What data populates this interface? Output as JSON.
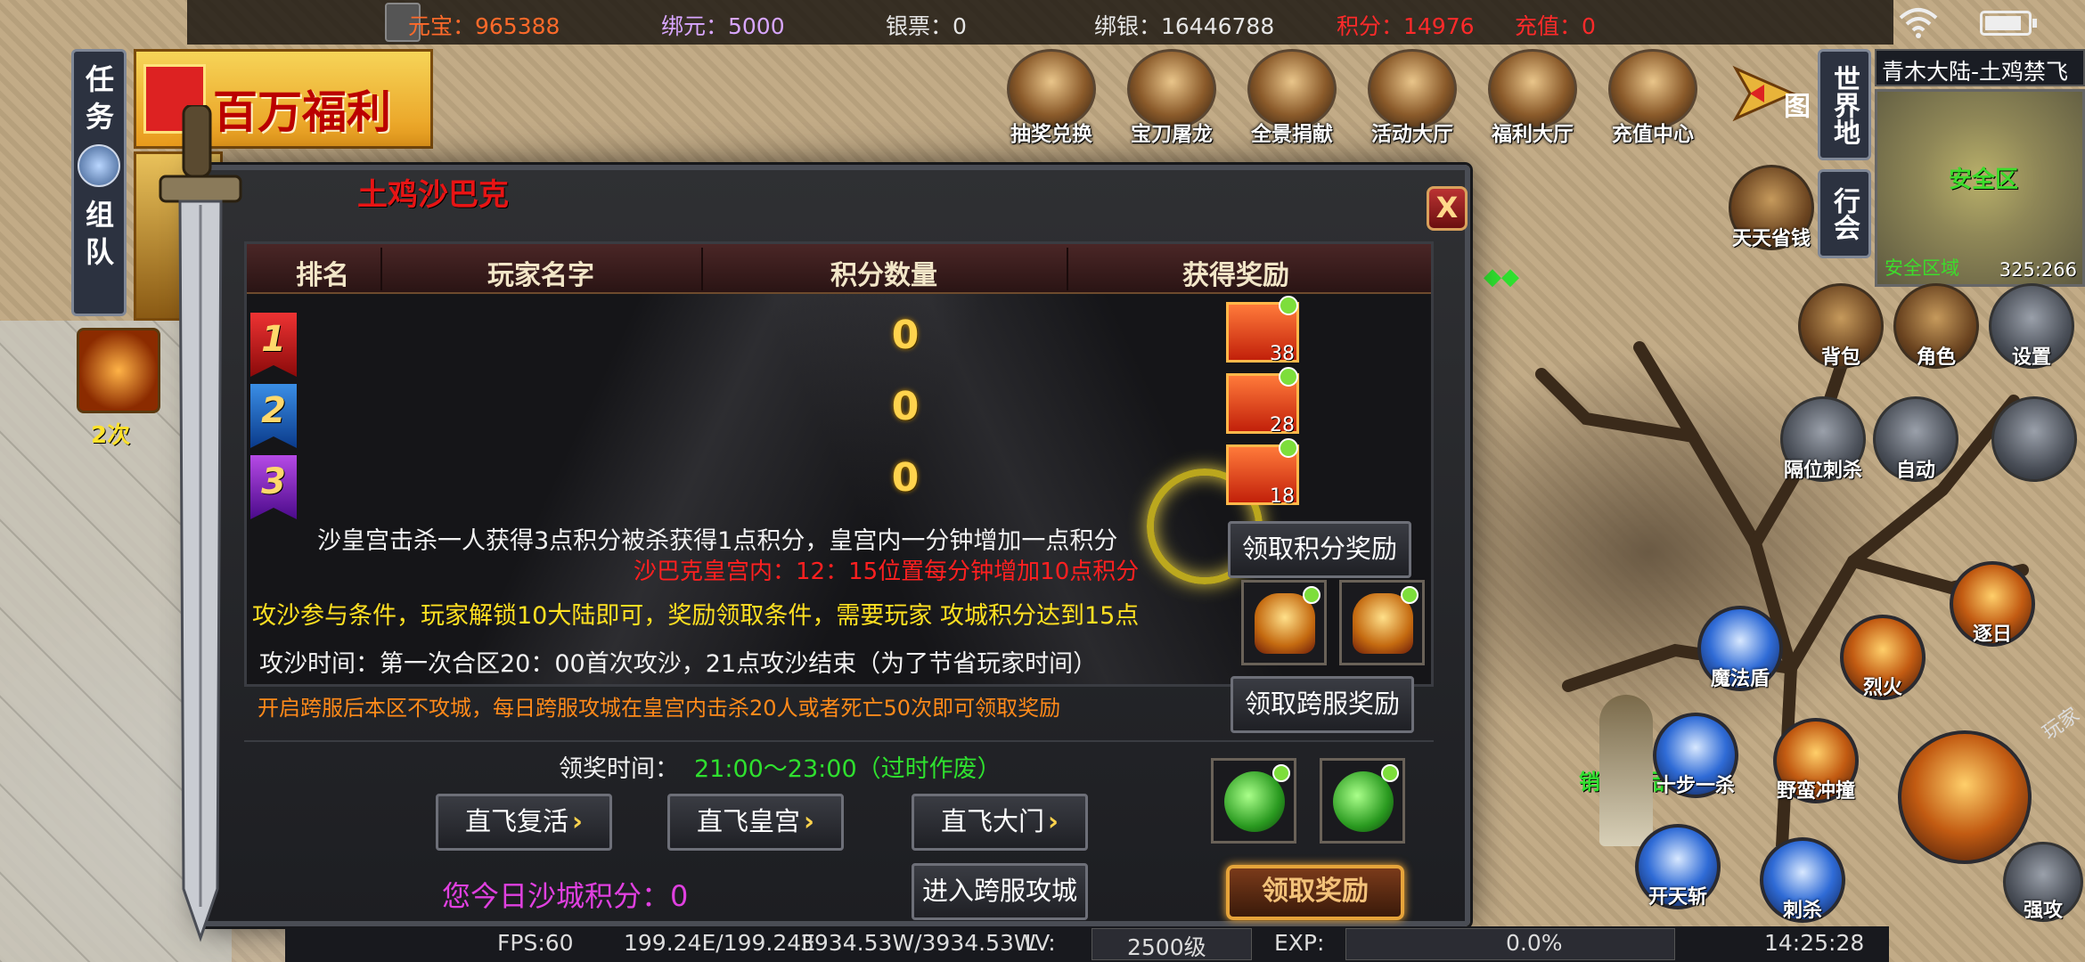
{
  "topbar": {
    "yuanbao": "元宝：965388",
    "bangyuan": "绑元：5000",
    "yinpiao": "银票：0",
    "bangyin": "绑银：16446788",
    "jifen": "积分：14976",
    "chongzhi": "充值：0"
  },
  "features": [
    "抽奖兑换",
    "宝刀屠龙",
    "全景捐献",
    "活动大厅",
    "福利大厅",
    "充值中心"
  ],
  "right_panel": {
    "world_map": "世界地图",
    "guild": "行会",
    "map_name": "青木大陆-土鸡禁飞",
    "safe_zone": "安全区",
    "area_label": "安全区域",
    "coords": "325:266",
    "save_money": "天天省钱",
    "bag": "背包",
    "role": "角色",
    "settings": "设置",
    "skill_stealth": "隔位刺杀",
    "auto": "自动"
  },
  "skills": [
    "逐日",
    "魔法盾",
    "烈火",
    "十步一杀",
    "野蛮冲撞",
    "开天斩",
    "刺杀",
    "强攻",
    "玩家"
  ],
  "left_panel": {
    "task": "任务",
    "team": "组队",
    "welfare": "百万福利",
    "charge_times": "2次"
  },
  "dialog": {
    "title": "土鸡沙巴克",
    "close": "X",
    "headers": [
      "排名",
      "玩家名字",
      "积分数量",
      "获得奖励"
    ],
    "rows": [
      {
        "rank": "1",
        "name": "",
        "score": "0",
        "reward_count": "38"
      },
      {
        "rank": "2",
        "name": "",
        "score": "0",
        "reward_count": "28"
      },
      {
        "rank": "3",
        "name": "",
        "score": "0",
        "reward_count": "18"
      }
    ],
    "rule1": "沙皇宫击杀一人获得3点积分被杀获得1点积分，皇宫内一分钟增加一点积分",
    "rule2": "沙巴克皇宫内：12：15位置每分钟增加10点积分",
    "rule3": "攻沙参与条件，玩家解锁10大陆即可，奖励领取条件，需要玩家 攻城积分达到15点",
    "rule4": "攻沙时间：第一次合区20：00首次攻沙，21点攻沙结束（为了节省玩家时间）",
    "rule5": "开启跨服后本区不攻城，每日跨服攻城在皇宫内击杀20人或者死亡50次即可领取奖励",
    "claim_points": "领取积分奖励",
    "claim_cross": "领取跨服奖励",
    "claim_time_label": "领奖时间：",
    "claim_time_value": "21:00～23:00（过时作废）",
    "fly_revive": "直飞复活",
    "fly_palace": "直飞皇宫",
    "fly_gate": "直飞大门",
    "enter_cross": "进入跨服攻城",
    "today_score": "您今日沙城积分：0",
    "claim_reward": "领取奖励"
  },
  "bottombar": {
    "fps": "FPS:60",
    "hp": "199.24E/199.24E",
    "mp": "3934.53W/3934.53W",
    "lv_label": "LV:",
    "lv": "2500级",
    "exp_label": "EXP:",
    "exp": "0.0%",
    "time": "14:25:28"
  },
  "world": {
    "npc": "销毁物品"
  },
  "colors": {
    "gold": "#ffd34d",
    "red": "#e81414",
    "green": "#2fe02f",
    "purple": "#e040e0"
  }
}
